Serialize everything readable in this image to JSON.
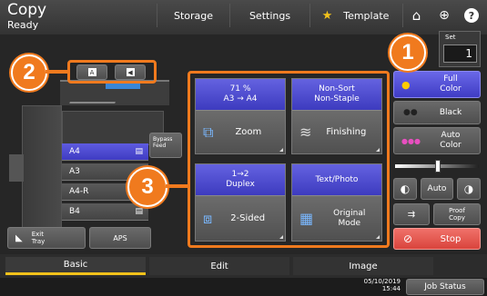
{
  "header": {
    "title": "Copy",
    "status": "Ready",
    "tabs": [
      "Storage",
      "Settings",
      "Template"
    ],
    "sets_label": "Set",
    "sets_value": "1"
  },
  "callouts": {
    "one": "1",
    "two": "2",
    "three": "3"
  },
  "paper": {
    "sizes": [
      "A4",
      "A3",
      "A4-R",
      "B4"
    ],
    "selected": "A4",
    "bypass_label": "Bypass\nFeed",
    "exit_tray_label": "Exit\nTray",
    "aps_label": "APS"
  },
  "functions": {
    "zoom_value": "71  %",
    "zoom_sizes": "A3   →   A4",
    "zoom_label": "Zoom",
    "finish_value": "Non-Sort\nNon-Staple",
    "finish_label": "Finishing",
    "duplex_value": "1→2\nDuplex",
    "duplex_label": "2-Sided",
    "mode_value": "Text/Photo",
    "mode_label": "Original\nMode"
  },
  "color": {
    "full_color": "Full\nColor",
    "black": "Black",
    "auto_color": "Auto\nColor"
  },
  "density": {
    "auto_label": "Auto"
  },
  "actions": {
    "proof_copy": "Proof\nCopy",
    "stop": "Stop"
  },
  "bottom_tabs": [
    "Basic",
    "Edit",
    "Image"
  ],
  "footer": {
    "date": "05/10/2019",
    "time": "15:44",
    "job_status": "Job Status"
  },
  "colors": {
    "accent_blue": "#4a47d0",
    "stop_red": "#e0534b",
    "callout_orange": "#f07a1e",
    "tab_underline": "#f2c21b"
  }
}
